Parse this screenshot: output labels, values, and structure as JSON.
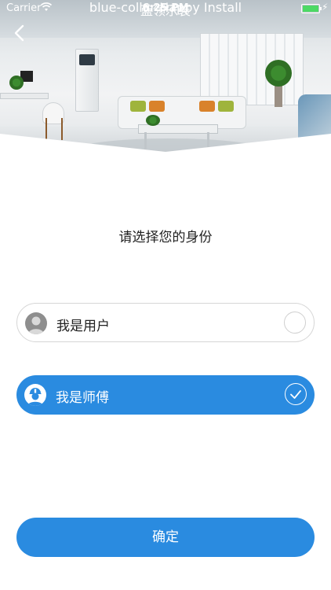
{
  "status_bar": {
    "carrier": "Carrier",
    "time": "6:25 PM",
    "battery_level": 1.0
  },
  "header": {
    "brand_title": "蓝领乐装",
    "brand_subtitle": "blue-collar Happy Install",
    "back_icon": "chevron-left-icon"
  },
  "main": {
    "heading": "请选择您的身份",
    "options": [
      {
        "label": "我是用户",
        "icon": "user-avatar-icon",
        "selected": false
      },
      {
        "label": "我是师傅",
        "icon": "worker-avatar-icon",
        "selected": true
      }
    ],
    "confirm_label": "确定"
  },
  "colors": {
    "accent": "#2a8be0",
    "border": "#d6d6d6",
    "battery": "#4cd964"
  }
}
